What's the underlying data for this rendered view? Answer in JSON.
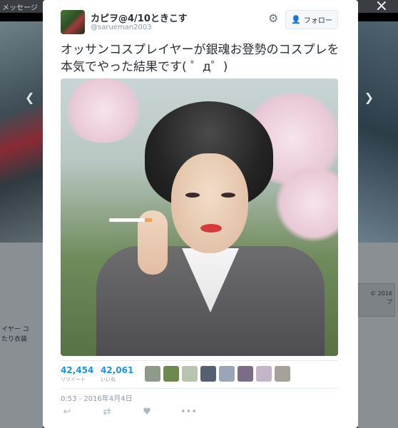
{
  "background": {
    "top_left_label": "メッセージ",
    "left_text_lines": [
      "イヤー コ",
      "たり衣装"
    ],
    "right_text_lines": [
      "© 2016",
      "プ"
    ]
  },
  "tweet": {
    "display_name": "カピヲ@4/10ときこす",
    "screen_name": "@sarueman2003",
    "follow_label": "フォロー",
    "text": "オッサンコスプレイヤーが銀魂お登勢のコスプレを本気でやった結果です( ゜д゜)",
    "retweets": {
      "count": "42,454",
      "label": "リツイート"
    },
    "likes": {
      "count": "42,061",
      "label": "いいね"
    },
    "timestamp": "0:53 - 2016年4月4日"
  },
  "icons": {
    "close": "close-icon",
    "prev": "chevron-left-icon",
    "next": "chevron-right-icon",
    "settings": "gear-icon",
    "follow": "add-user-icon",
    "reply": "reply-icon",
    "retweet": "retweet-icon",
    "like": "heart-icon",
    "more": "more-icon"
  },
  "colors": {
    "accent": "#1b95e0",
    "follow_icon": "#55acee",
    "muted": "#8899a6"
  }
}
